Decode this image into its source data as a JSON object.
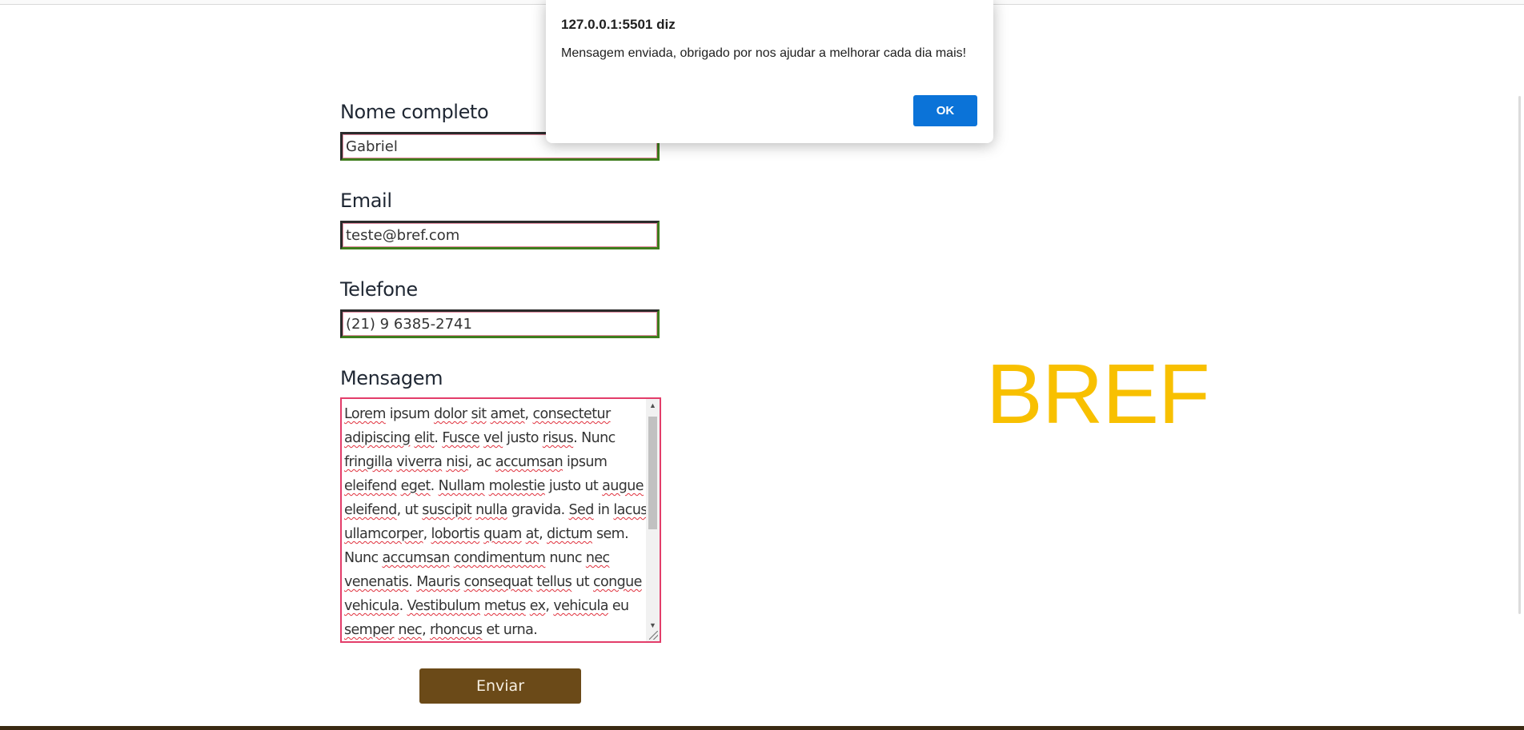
{
  "brand": {
    "text": "BREF",
    "color": "#f8c000"
  },
  "form": {
    "name_label": "Nome completo",
    "name_value": "Gabriel",
    "email_label": "Email",
    "email_value": "teste@bref.com",
    "phone_label": "Telefone",
    "phone_value": "(21) 9 6385-2741",
    "message_label": "Mensagem",
    "message_value": "Lorem ipsum dolor sit amet, consectetur adipiscing elit. Fusce vel justo risus. Nunc fringilla viverra nisi, ac accumsan ipsum eleifend eget. Nullam molestie justo ut augue eleifend, ut suscipit nulla gravida. Sed in lacus ullamcorper, lobortis quam at, dictum sem. Nunc accumsan condimentum nunc nec venenatis. Mauris consequat tellus ut congue vehicula. Vestibulum metus ex, vehicula eu semper nec, rhoncus et urna.",
    "submit_label": "Enviar",
    "submit_color": "#6b4a18"
  },
  "alert": {
    "title": "127.0.0.1:5501 diz",
    "message": "Mensagem enviada, obrigado por nos ajudar a melhorar cada dia mais!",
    "ok_label": "OK",
    "ok_color": "#0b73d8"
  }
}
